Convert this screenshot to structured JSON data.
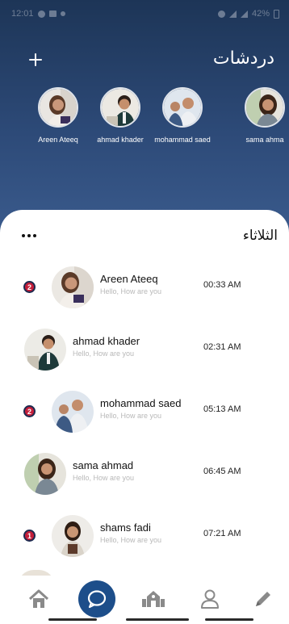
{
  "status_bar": {
    "time": "12:01",
    "battery": "42%"
  },
  "header": {
    "title": "دردشات",
    "add_label": "+"
  },
  "stories": [
    {
      "name": "Areen Ateeq"
    },
    {
      "name": "ahmad khader"
    },
    {
      "name": "mohammad  saed"
    },
    {
      "name": "sama ahma"
    }
  ],
  "sheet": {
    "day_label": "الثلاثاء"
  },
  "chats": [
    {
      "name": "Areen Ateeq",
      "message": "Hello, How are you",
      "time": "00:33 AM",
      "unread": "2"
    },
    {
      "name": "ahmad khader",
      "message": "Hello, How are you",
      "time": "02:31 AM",
      "unread": ""
    },
    {
      "name": "mohammad  saed",
      "message": "Hello, How are you",
      "time": "05:13 AM",
      "unread": "2"
    },
    {
      "name": "sama ahmad",
      "message": "Hello, How are you",
      "time": "06:45 AM",
      "unread": ""
    },
    {
      "name": "shams fadi",
      "message": "Hello, How are you",
      "time": "07:21 AM",
      "unread": "1"
    }
  ],
  "nav": [
    {
      "icon": "home-icon"
    },
    {
      "icon": "chat-bubble-icon",
      "active": true
    },
    {
      "icon": "school-icon"
    },
    {
      "icon": "person-icon"
    },
    {
      "icon": "pencil-icon"
    }
  ],
  "colors": {
    "header_top": "#1d3557",
    "header_bottom": "#3b5c8e",
    "badge": "#c41e3a",
    "nav_active": "#1d4e8a"
  }
}
